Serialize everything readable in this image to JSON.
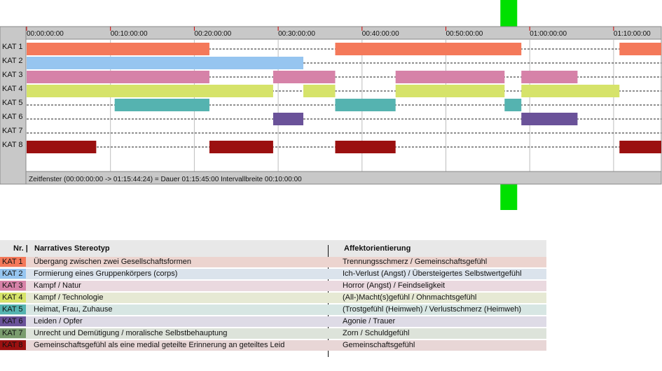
{
  "chart_data": {
    "type": "timeline",
    "x_unit": "hh:mm:ss",
    "xlim": [
      "00:00:00",
      "01:15:44:24"
    ],
    "tick_labels": [
      "00:00:00:00",
      "00:10:00:00",
      "00:20:00:00",
      "00:30:00:00",
      "00:40:00:00",
      "00:50:00:00",
      "01:00:00:00",
      "01:10:00:00"
    ],
    "categories": [
      {
        "label": "KAT 1",
        "color": "#f4795a",
        "segments": [
          [
            0,
            21.8
          ],
          [
            36.8,
            59.0
          ],
          [
            70.7,
            75.75
          ]
        ]
      },
      {
        "label": "KAT 2",
        "color": "#96c5f0",
        "segments": [
          [
            0,
            33.0
          ]
        ]
      },
      {
        "label": "KAT 3",
        "color": "#d682a8",
        "segments": [
          [
            0,
            21.8
          ],
          [
            29.4,
            36.8
          ],
          [
            44.0,
            57.0
          ],
          [
            59.0,
            65.7
          ]
        ]
      },
      {
        "label": "KAT 4",
        "color": "#d6e36a",
        "segments": [
          [
            0,
            29.4
          ],
          [
            33.0,
            36.8
          ],
          [
            44.0,
            57.0
          ],
          [
            59.0,
            70.7
          ]
        ]
      },
      {
        "label": "KAT 5",
        "color": "#55b3b0",
        "segments": [
          [
            10.5,
            21.8
          ],
          [
            36.8,
            44.0
          ],
          [
            57.0,
            59.0
          ]
        ]
      },
      {
        "label": "KAT 6",
        "color": "#6a5299",
        "segments": [
          [
            29.4,
            33.0
          ],
          [
            59.0,
            65.7
          ]
        ]
      },
      {
        "label": "KAT 7",
        "color": "#7a9c6e",
        "segments": []
      },
      {
        "label": "KAT 8",
        "color": "#9b1010",
        "segments": [
          [
            0,
            8.3
          ],
          [
            21.8,
            29.4
          ],
          [
            36.8,
            44.0
          ],
          [
            70.7,
            75.75
          ]
        ]
      }
    ],
    "cursor_minutes": 57.5,
    "status_text": "Zeitfenster (00:00:00:00 -> 01:15:44:24) = Dauer 01:15:45:00     Intervallbreite 00:10:00:00"
  },
  "legend": {
    "header": {
      "nr": "Nr. |",
      "narrative": "Narratives Stereotyp",
      "affect": "Affektorientierung"
    },
    "rows": [
      {
        "kat": "KAT 1",
        "chip_color": "#f4795a",
        "bg": "#ecd4cf",
        "narrative": "Übergang zwischen zwei Gesellschaftsformen",
        "affect": "Trennungsschmerz / Gemeinschaftsgefühl"
      },
      {
        "kat": "KAT 2",
        "chip_color": "#96c5f0",
        "bg": "#dbe3ec",
        "narrative": "Formierung eines Gruppenkörpers (corps)",
        "affect": "Ich-Verlust (Angst) / Übersteigertes Selbstwertgefühl"
      },
      {
        "kat": "KAT 3",
        "chip_color": "#d682a8",
        "bg": "#ead9df",
        "narrative": "Kampf / Natur",
        "affect": "Horror (Angst) / Feindseligkeit"
      },
      {
        "kat": "KAT 4",
        "chip_color": "#d6e36a",
        "bg": "#e6e9d4",
        "narrative": "Kampf / Technologie",
        "affect": "(All-)Macht(s)gefühl / Ohnmachtsgefühl"
      },
      {
        "kat": "KAT 5",
        "chip_color": "#55b3b0",
        "bg": "#d7e6e3",
        "narrative": "Heimat, Frau, Zuhause",
        "affect": "(Trostgefühl (Heimweh) / Verlustschmerz (Heimweh)"
      },
      {
        "kat": "KAT 6",
        "chip_color": "#6a5299",
        "bg": "#dedbe6",
        "narrative": "Leiden / Opfer",
        "affect": "Agonie / Trauer"
      },
      {
        "kat": "KAT 7",
        "chip_color": "#7a9c6e",
        "bg": "#dde3da",
        "narrative": "Unrecht und Demütigung / moralische Selbstbehauptung",
        "affect": "Zorn / Schuldgefühl"
      },
      {
        "kat": "KAT 8",
        "chip_color": "#9b1010",
        "bg": "#e8d6d6",
        "narrative": "Gemeinschaftsgefühl als eine medial geteilte Erinnerung an geteiltes Leid",
        "affect": "Gemeinschaftsgefühl"
      }
    ]
  }
}
